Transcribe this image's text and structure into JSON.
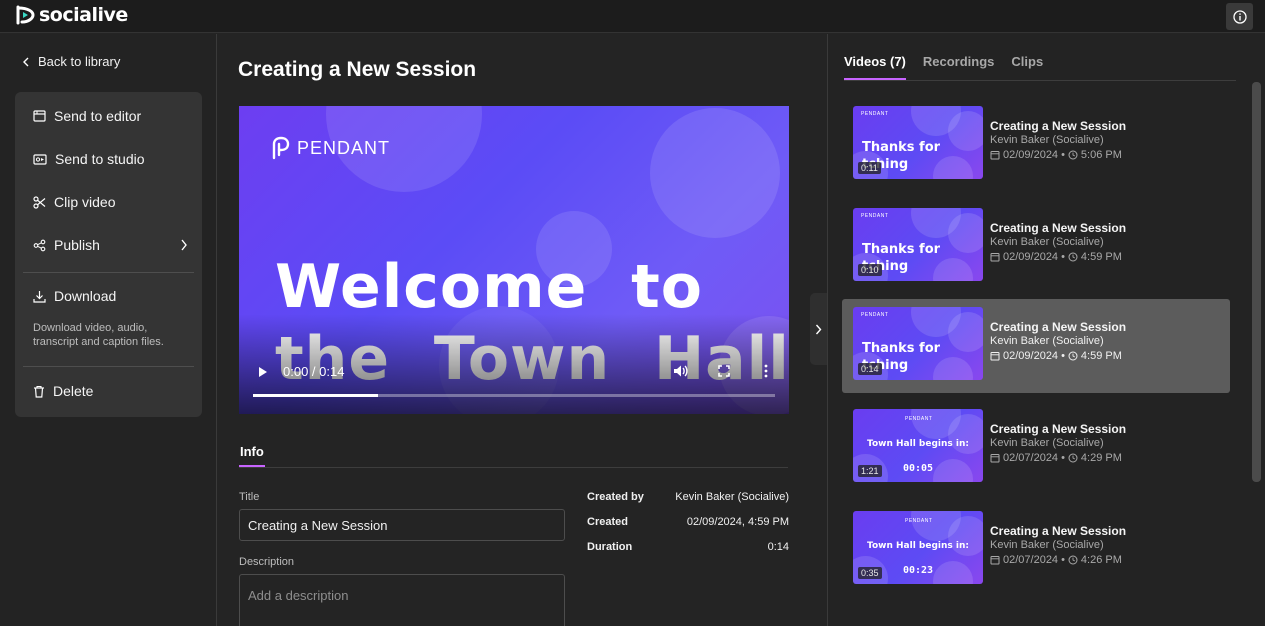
{
  "app": {
    "name": "socialive"
  },
  "sidebar": {
    "back_label": "Back to library",
    "actions": {
      "send_to_editor": "Send to editor",
      "send_to_studio": "Send to studio",
      "clip_video": "Clip video",
      "publish": "Publish",
      "download": "Download",
      "download_desc": "Download video, audio, transcript and caption files.",
      "delete": "Delete"
    }
  },
  "main": {
    "title": "Creating a New Session",
    "player": {
      "brand": "PENDANT",
      "headline": "Welcome  to\nthe  Town  Hall",
      "time": "0:00 / 0:14",
      "progress": 0.24
    },
    "info_tab": "Info",
    "fields": {
      "title_label": "Title",
      "title_value": "Creating a New Session",
      "description_label": "Description",
      "description_placeholder": "Add a description"
    },
    "meta": [
      {
        "key": "Created by",
        "value": "Kevin Baker (Socialive)"
      },
      {
        "key": "Created",
        "value": "02/09/2024, 4:59 PM"
      },
      {
        "key": "Duration",
        "value": "0:14"
      }
    ]
  },
  "right": {
    "tabs": [
      "Videos (7)",
      "Recordings",
      "Clips"
    ],
    "videos": [
      {
        "title": "Creating a New Session",
        "author": "Kevin Baker (Socialive)",
        "date": "02/09/2024",
        "time": "5:06 PM",
        "duration": "0:11",
        "thumb_text": "Thanks for\ntching",
        "thumb_kind": "thanks",
        "brand": "PENDANT"
      },
      {
        "title": "Creating a New Session",
        "author": "Kevin Baker (Socialive)",
        "date": "02/09/2024",
        "time": "4:59 PM",
        "duration": "0:10",
        "thumb_text": "Thanks for\ntching",
        "thumb_kind": "thanks",
        "brand": "PENDANT"
      },
      {
        "title": "Creating a New Session",
        "author": "Kevin Baker (Socialive)",
        "date": "02/09/2024",
        "time": "4:59 PM",
        "duration": "0:14",
        "thumb_text": "Thanks for\ntching",
        "thumb_kind": "thanks",
        "brand": "PENDANT",
        "selected": true
      },
      {
        "title": "Creating a New Session",
        "author": "Kevin Baker (Socialive)",
        "date": "02/07/2024",
        "time": "4:29 PM",
        "duration": "1:21",
        "thumb_text": "Town Hall begins in:",
        "thumb_count": "00:05",
        "thumb_kind": "countdown",
        "brand": "PENDANT"
      },
      {
        "title": "Creating a New Session",
        "author": "Kevin Baker (Socialive)",
        "date": "02/07/2024",
        "time": "4:26 PM",
        "duration": "0:35",
        "thumb_text": "Town Hall begins in:",
        "thumb_count": "00:23",
        "thumb_kind": "countdown",
        "brand": "PENDANT"
      }
    ]
  },
  "colors": {
    "accent": "#c764ff",
    "selected_row": "#5c5c5c",
    "video_purple": "#6d3ef1"
  },
  "icons": [
    "socialive-logo-icon",
    "info-icon",
    "chevron-left-icon",
    "editor-icon",
    "studio-icon",
    "scissors-icon",
    "share-icon",
    "chevron-right-icon",
    "download-icon",
    "trash-icon",
    "play-icon",
    "volume-icon",
    "fullscreen-icon",
    "more-vertical-icon",
    "calendar-icon",
    "clock-icon"
  ]
}
